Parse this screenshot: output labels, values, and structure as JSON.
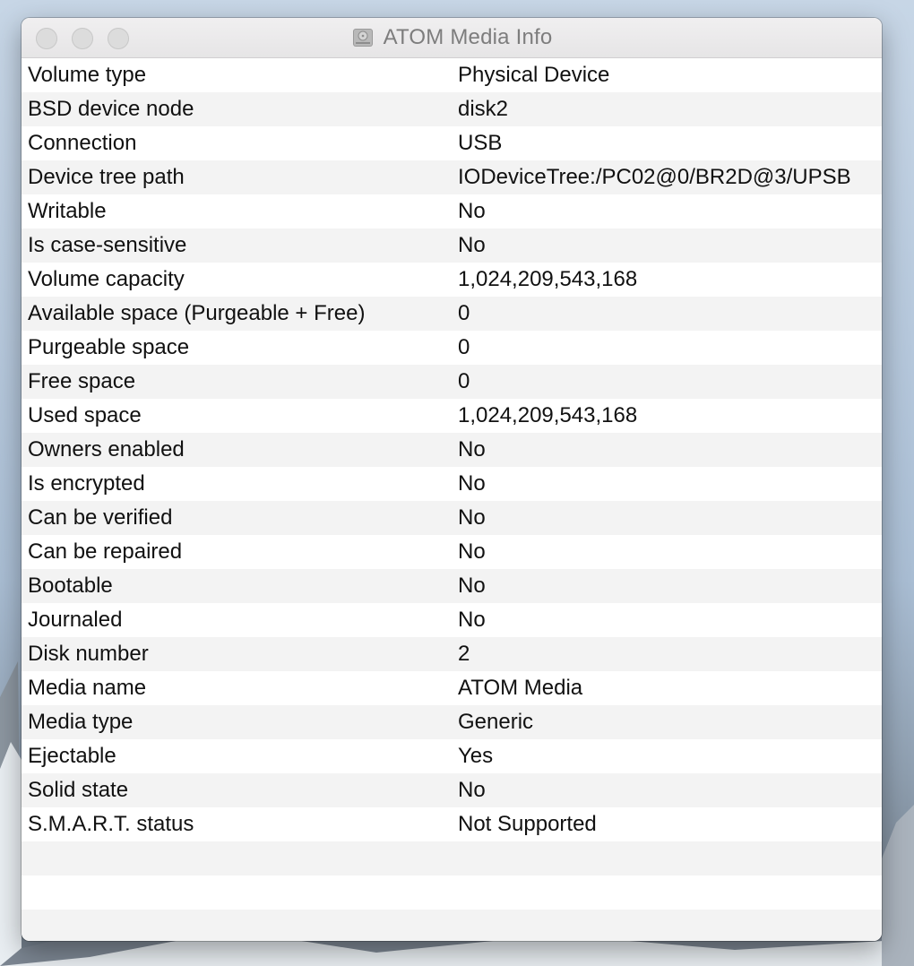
{
  "window": {
    "title": "ATOM Media Info",
    "title_icon": "drive-icon"
  },
  "info": [
    {
      "label": "Volume type",
      "value": "Physical Device"
    },
    {
      "label": "BSD device node",
      "value": "disk2"
    },
    {
      "label": "Connection",
      "value": "USB"
    },
    {
      "label": "Device tree path",
      "value": "IODeviceTree:/PC02@0/BR2D@3/UPSB"
    },
    {
      "label": "Writable",
      "value": "No"
    },
    {
      "label": "Is case-sensitive",
      "value": "No"
    },
    {
      "label": "Volume capacity",
      "value": "1,024,209,543,168"
    },
    {
      "label": "Available space (Purgeable + Free)",
      "value": "0"
    },
    {
      "label": "Purgeable space",
      "value": "0"
    },
    {
      "label": "Free space",
      "value": "0"
    },
    {
      "label": "Used space",
      "value": "1,024,209,543,168"
    },
    {
      "label": "Owners enabled",
      "value": "No"
    },
    {
      "label": "Is encrypted",
      "value": "No"
    },
    {
      "label": "Can be verified",
      "value": "No"
    },
    {
      "label": "Can be repaired",
      "value": "No"
    },
    {
      "label": "Bootable",
      "value": "No"
    },
    {
      "label": "Journaled",
      "value": "No"
    },
    {
      "label": "Disk number",
      "value": "2"
    },
    {
      "label": "Media name",
      "value": "ATOM Media"
    },
    {
      "label": "Media type",
      "value": "Generic"
    },
    {
      "label": "Ejectable",
      "value": "Yes"
    },
    {
      "label": "Solid state",
      "value": "No"
    },
    {
      "label": "S.M.A.R.T. status",
      "value": "Not Supported"
    }
  ]
}
